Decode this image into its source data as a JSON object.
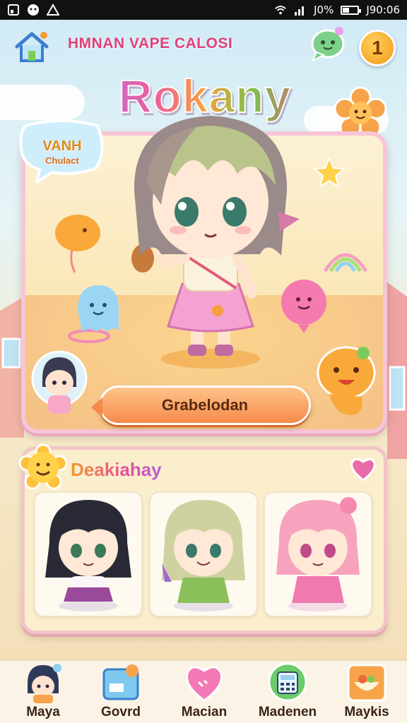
{
  "status_bar": {
    "battery_text": "J0%",
    "time": "J90:06"
  },
  "header": {
    "subtitle": "HMNAN VAPE CALOSI",
    "coin_value": "1",
    "app_title": "Rokany"
  },
  "featured_card": {
    "badge_line1": "VANH",
    "badge_line2": "Chulact",
    "action_label": "Grabelodan"
  },
  "gallery": {
    "title": "Deakiahay"
  },
  "bottom_nav": {
    "items": [
      {
        "label": "Maya",
        "icon": "avatar-icon"
      },
      {
        "label": "Govrd",
        "icon": "card-icon"
      },
      {
        "label": "Macian",
        "icon": "heart-icon"
      },
      {
        "label": "Madenen",
        "icon": "calculator-icon"
      },
      {
        "label": "Maykis",
        "icon": "bowl-icon"
      }
    ]
  },
  "colors": {
    "accent_pink": "#e0407a",
    "coin_orange": "#f29a1a",
    "card_border": "#f7c5d6",
    "button_orange": "#f58a4a"
  }
}
